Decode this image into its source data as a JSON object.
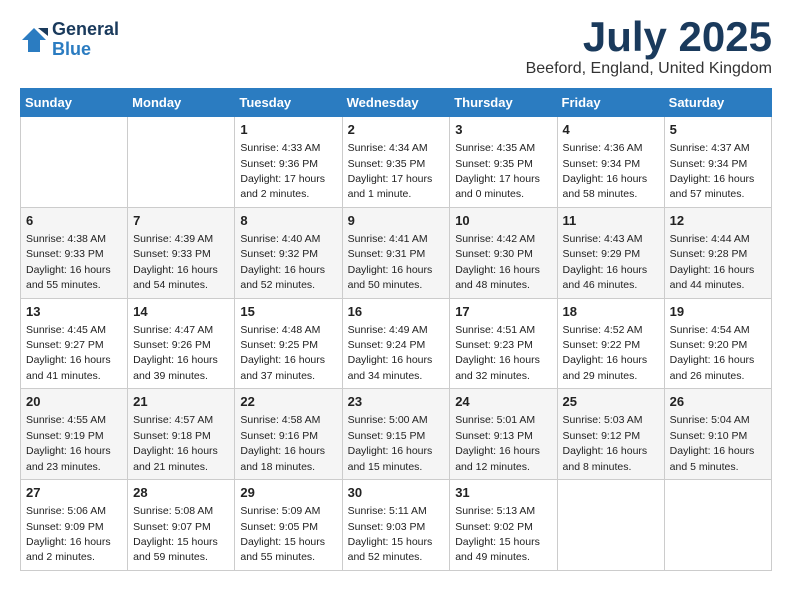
{
  "logo": {
    "general": "General",
    "blue": "Blue"
  },
  "title": "July 2025",
  "location": "Beeford, England, United Kingdom",
  "weekdays": [
    "Sunday",
    "Monday",
    "Tuesday",
    "Wednesday",
    "Thursday",
    "Friday",
    "Saturday"
  ],
  "weeks": [
    [
      {
        "day": "",
        "info": ""
      },
      {
        "day": "",
        "info": ""
      },
      {
        "day": "1",
        "info": "Sunrise: 4:33 AM\nSunset: 9:36 PM\nDaylight: 17 hours\nand 2 minutes."
      },
      {
        "day": "2",
        "info": "Sunrise: 4:34 AM\nSunset: 9:35 PM\nDaylight: 17 hours\nand 1 minute."
      },
      {
        "day": "3",
        "info": "Sunrise: 4:35 AM\nSunset: 9:35 PM\nDaylight: 17 hours\nand 0 minutes."
      },
      {
        "day": "4",
        "info": "Sunrise: 4:36 AM\nSunset: 9:34 PM\nDaylight: 16 hours\nand 58 minutes."
      },
      {
        "day": "5",
        "info": "Sunrise: 4:37 AM\nSunset: 9:34 PM\nDaylight: 16 hours\nand 57 minutes."
      }
    ],
    [
      {
        "day": "6",
        "info": "Sunrise: 4:38 AM\nSunset: 9:33 PM\nDaylight: 16 hours\nand 55 minutes."
      },
      {
        "day": "7",
        "info": "Sunrise: 4:39 AM\nSunset: 9:33 PM\nDaylight: 16 hours\nand 54 minutes."
      },
      {
        "day": "8",
        "info": "Sunrise: 4:40 AM\nSunset: 9:32 PM\nDaylight: 16 hours\nand 52 minutes."
      },
      {
        "day": "9",
        "info": "Sunrise: 4:41 AM\nSunset: 9:31 PM\nDaylight: 16 hours\nand 50 minutes."
      },
      {
        "day": "10",
        "info": "Sunrise: 4:42 AM\nSunset: 9:30 PM\nDaylight: 16 hours\nand 48 minutes."
      },
      {
        "day": "11",
        "info": "Sunrise: 4:43 AM\nSunset: 9:29 PM\nDaylight: 16 hours\nand 46 minutes."
      },
      {
        "day": "12",
        "info": "Sunrise: 4:44 AM\nSunset: 9:28 PM\nDaylight: 16 hours\nand 44 minutes."
      }
    ],
    [
      {
        "day": "13",
        "info": "Sunrise: 4:45 AM\nSunset: 9:27 PM\nDaylight: 16 hours\nand 41 minutes."
      },
      {
        "day": "14",
        "info": "Sunrise: 4:47 AM\nSunset: 9:26 PM\nDaylight: 16 hours\nand 39 minutes."
      },
      {
        "day": "15",
        "info": "Sunrise: 4:48 AM\nSunset: 9:25 PM\nDaylight: 16 hours\nand 37 minutes."
      },
      {
        "day": "16",
        "info": "Sunrise: 4:49 AM\nSunset: 9:24 PM\nDaylight: 16 hours\nand 34 minutes."
      },
      {
        "day": "17",
        "info": "Sunrise: 4:51 AM\nSunset: 9:23 PM\nDaylight: 16 hours\nand 32 minutes."
      },
      {
        "day": "18",
        "info": "Sunrise: 4:52 AM\nSunset: 9:22 PM\nDaylight: 16 hours\nand 29 minutes."
      },
      {
        "day": "19",
        "info": "Sunrise: 4:54 AM\nSunset: 9:20 PM\nDaylight: 16 hours\nand 26 minutes."
      }
    ],
    [
      {
        "day": "20",
        "info": "Sunrise: 4:55 AM\nSunset: 9:19 PM\nDaylight: 16 hours\nand 23 minutes."
      },
      {
        "day": "21",
        "info": "Sunrise: 4:57 AM\nSunset: 9:18 PM\nDaylight: 16 hours\nand 21 minutes."
      },
      {
        "day": "22",
        "info": "Sunrise: 4:58 AM\nSunset: 9:16 PM\nDaylight: 16 hours\nand 18 minutes."
      },
      {
        "day": "23",
        "info": "Sunrise: 5:00 AM\nSunset: 9:15 PM\nDaylight: 16 hours\nand 15 minutes."
      },
      {
        "day": "24",
        "info": "Sunrise: 5:01 AM\nSunset: 9:13 PM\nDaylight: 16 hours\nand 12 minutes."
      },
      {
        "day": "25",
        "info": "Sunrise: 5:03 AM\nSunset: 9:12 PM\nDaylight: 16 hours\nand 8 minutes."
      },
      {
        "day": "26",
        "info": "Sunrise: 5:04 AM\nSunset: 9:10 PM\nDaylight: 16 hours\nand 5 minutes."
      }
    ],
    [
      {
        "day": "27",
        "info": "Sunrise: 5:06 AM\nSunset: 9:09 PM\nDaylight: 16 hours\nand 2 minutes."
      },
      {
        "day": "28",
        "info": "Sunrise: 5:08 AM\nSunset: 9:07 PM\nDaylight: 15 hours\nand 59 minutes."
      },
      {
        "day": "29",
        "info": "Sunrise: 5:09 AM\nSunset: 9:05 PM\nDaylight: 15 hours\nand 55 minutes."
      },
      {
        "day": "30",
        "info": "Sunrise: 5:11 AM\nSunset: 9:03 PM\nDaylight: 15 hours\nand 52 minutes."
      },
      {
        "day": "31",
        "info": "Sunrise: 5:13 AM\nSunset: 9:02 PM\nDaylight: 15 hours\nand 49 minutes."
      },
      {
        "day": "",
        "info": ""
      },
      {
        "day": "",
        "info": ""
      }
    ]
  ]
}
